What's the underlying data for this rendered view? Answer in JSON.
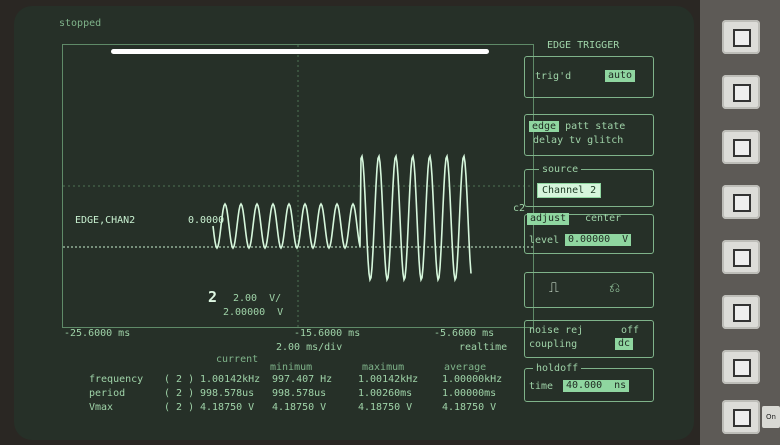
{
  "status": {
    "label": "stopped"
  },
  "trigger_panel": {
    "title": "EDGE TRIGGER",
    "trigd_label": "trig'd",
    "auto_label": "auto",
    "mode_line1_hl": "edge",
    "mode_line1_rest": " patt state",
    "mode_line2": "delay tv glitch"
  },
  "source_panel": {
    "title": "source",
    "value": "Channel 2"
  },
  "level_panel": {
    "adjust_label": "adjust",
    "center_label": "center",
    "level_label": "level",
    "level_value": "0.00000  V"
  },
  "slope_panel": {
    "rise_symbol": "⎍",
    "fall_symbol": "⎌"
  },
  "noise_panel": {
    "noise_label": "noise rej",
    "noise_value": "off",
    "coupling_label": "coupling",
    "coupling_value": "dc"
  },
  "holdoff_panel": {
    "title": "holdoff",
    "time_label": "time",
    "time_value": "40.000  ns"
  },
  "scope": {
    "trigger_label": "EDGE,CHAN2",
    "trigger_value": "0.0000",
    "c2_label": "c2",
    "ch_number": "2",
    "vdiv": "2.00  V/",
    "offset": "2.00000  V",
    "x_left": "-25.6000 ms",
    "x_center": "-15.6000 ms",
    "x_right": "-5.6000 ms",
    "time_div": "2.00 ms/div",
    "realtime": "realtime"
  },
  "measurements": {
    "headers": {
      "current": "current",
      "minimum": "minimum",
      "maximum": "maximum",
      "average": "average"
    },
    "rows": [
      {
        "name": "frequency",
        "ch": "( 2 )",
        "current": "1.00142kHz",
        "minimum": "997.407 Hz",
        "maximum": "1.00142kHz",
        "average": "1.00000kHz"
      },
      {
        "name": "period",
        "ch": "( 2 )",
        "current": "998.578us",
        "minimum": "998.578us",
        "maximum": "1.00260ms",
        "average": "1.00000ms"
      },
      {
        "name": "Vmax",
        "ch": "( 2 )",
        "current": "4.18750 V",
        "minimum": "4.18750 V",
        "maximum": "4.18750 V",
        "average": "4.18750 V"
      }
    ]
  },
  "side_panel": {
    "on_label": "On"
  }
}
